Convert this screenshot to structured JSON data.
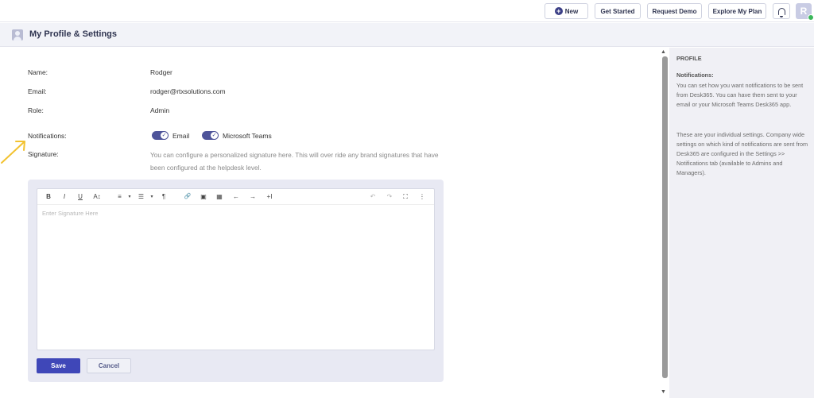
{
  "topbar": {
    "new_label": "New",
    "get_started_label": "Get Started",
    "request_demo_label": "Request Demo",
    "explore_plan_label": "Explore My Plan",
    "avatar_initial": "R"
  },
  "header": {
    "title": "My Profile & Settings"
  },
  "profile": {
    "name_label": "Name:",
    "name_value": "Rodger",
    "email_label": "Email:",
    "email_value": "rodger@rtxsolutions.com",
    "role_label": "Role:",
    "role_value": "Admin",
    "notifications_label": "Notifications:",
    "notifications": [
      {
        "label": "Email",
        "enabled": true
      },
      {
        "label": "Microsoft Teams",
        "enabled": true
      }
    ],
    "signature_label": "Signature:",
    "signature_desc": "You can configure a personalized signature here. This will over ride any brand signatures that have been configured at the helpdesk level."
  },
  "editor": {
    "placeholder": "Enter Signature Here",
    "tools": [
      "B",
      "I",
      "U",
      "A↕",
      "≡",
      "▾",
      "☰",
      "▾",
      "¶",
      "🔗",
      "▣",
      "▦",
      "←",
      "→",
      "+I",
      "↶",
      "↷",
      "⛶",
      "⋮"
    ]
  },
  "actions": {
    "save_label": "Save",
    "cancel_label": "Cancel"
  },
  "sidepanel": {
    "title": "PROFILE",
    "subtitle": "Notifications:",
    "para1": "You can set how you want notifications to be sent from Desk365. You can have them sent to your email or your Microsoft Teams Desk365 app.",
    "para2": "These are your individual settings. Company wide settings on which kind of notifications are sent from Desk365 are configured in the Settings >> Notifications tab (available to Admins and Managers)."
  },
  "colors": {
    "accent": "#3f47b8",
    "toggle_on": "#4e549a",
    "arrow": "#f2c230"
  }
}
